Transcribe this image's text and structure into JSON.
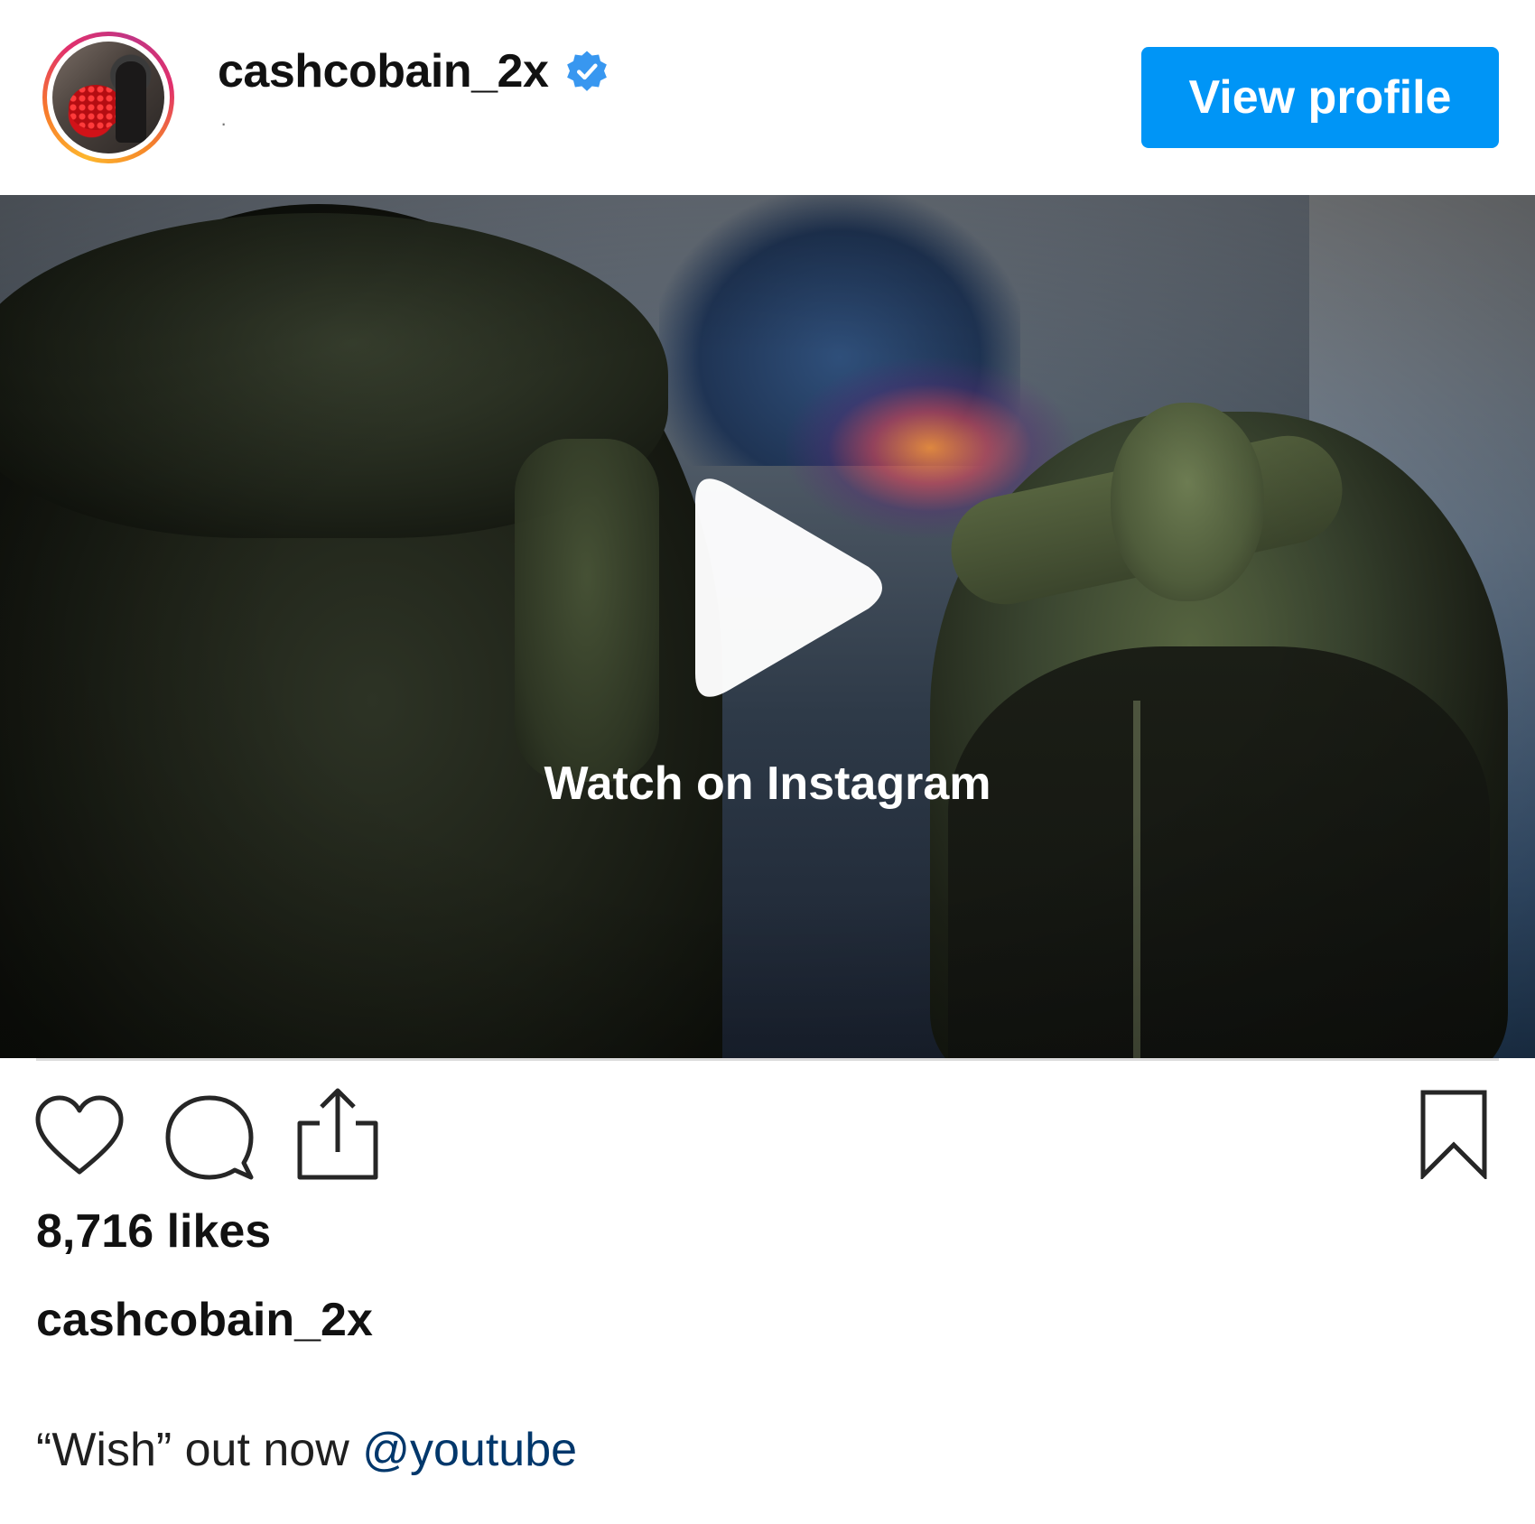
{
  "header": {
    "username": "cashcobain_2x",
    "subtitle": "·",
    "verified": true,
    "view_profile_label": "View profile"
  },
  "media": {
    "overlay_label": "Watch on Instagram",
    "type": "video"
  },
  "actions": {
    "icons": [
      "heart-icon",
      "comment-icon",
      "share-icon",
      "bookmark-icon"
    ]
  },
  "post": {
    "likes": "8,716 likes",
    "caption_user": "cashcobain_2x",
    "caption_text": "“Wish” out now ",
    "caption_mention": "@youtube"
  },
  "colors": {
    "primary_button": "#0095f6",
    "verified_badge": "#3897f0",
    "mention_link": "#00376b",
    "divider": "#dbdbdb"
  }
}
